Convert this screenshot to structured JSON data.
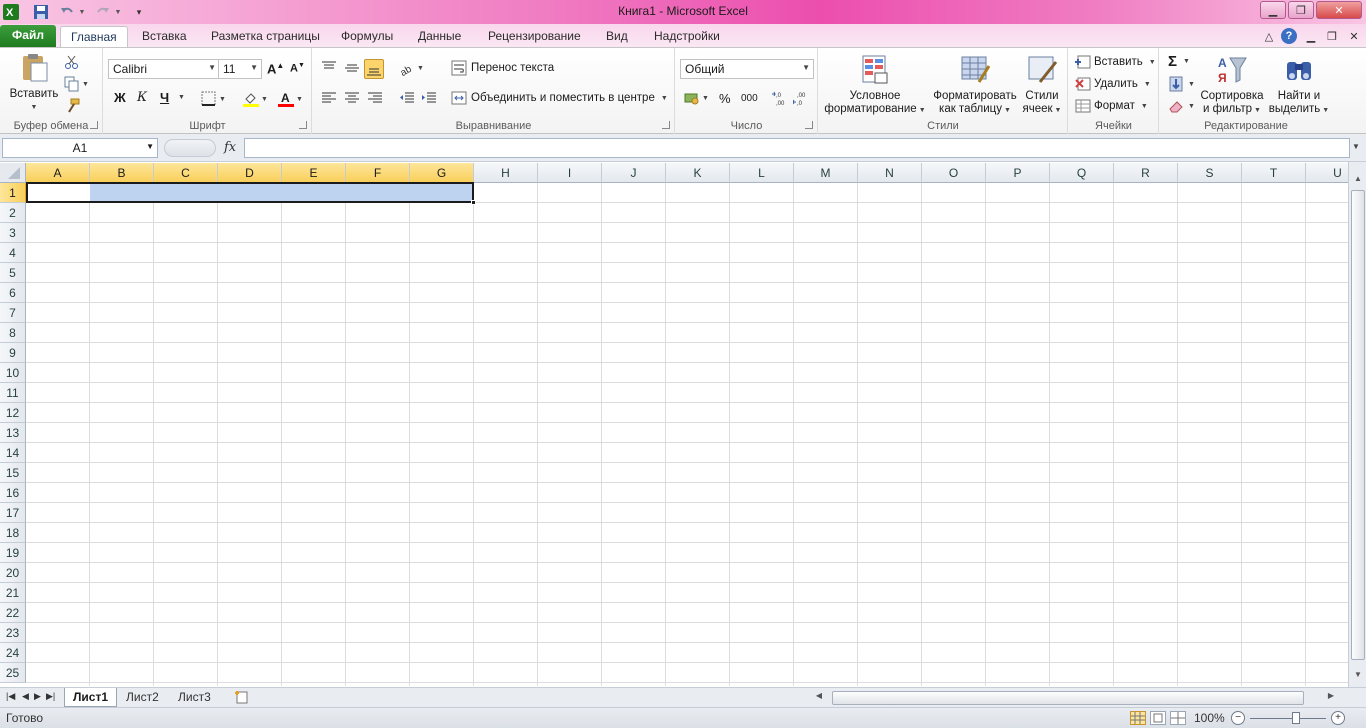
{
  "window": {
    "title": "Книга1  -  Microsoft Excel"
  },
  "tabs": {
    "file": "Файл",
    "items": [
      "Главная",
      "Вставка",
      "Разметка страницы",
      "Формулы",
      "Данные",
      "Рецензирование",
      "Вид",
      "Надстройки"
    ],
    "active": "Главная"
  },
  "ribbon": {
    "clipboard": {
      "paste": "Вставить",
      "label": "Буфер обмена"
    },
    "font": {
      "name": "Calibri",
      "size": "11",
      "bold": "Ж",
      "italic": "К",
      "underline": "Ч",
      "label": "Шрифт"
    },
    "alignment": {
      "wrap": "Перенос текста",
      "merge": "Объединить и поместить в центре",
      "label": "Выравнивание"
    },
    "number": {
      "format": "Общий",
      "percent": "%",
      "thousands": "000",
      "label": "Число"
    },
    "styles": {
      "conditional_l1": "Условное",
      "conditional_l2": "форматирование",
      "format_table_l1": "Форматировать",
      "format_table_l2": "как таблицу",
      "cell_styles_l1": "Стили",
      "cell_styles_l2": "ячеек",
      "label": "Стили"
    },
    "cells": {
      "insert": "Вставить",
      "delete": "Удалить",
      "format": "Формат",
      "label": "Ячейки"
    },
    "editing": {
      "sum": "Σ",
      "sort_l1": "Сортировка",
      "sort_l2": "и фильтр",
      "find_l1": "Найти и",
      "find_l2": "выделить",
      "label": "Редактирование"
    }
  },
  "formula_bar": {
    "name_box": "A1",
    "fx": "fx",
    "value": ""
  },
  "grid": {
    "columns": [
      "A",
      "B",
      "C",
      "D",
      "E",
      "F",
      "G",
      "H",
      "I",
      "J",
      "K",
      "L",
      "M",
      "N",
      "O",
      "P",
      "Q",
      "R",
      "S",
      "T",
      "U"
    ],
    "rows": [
      "1",
      "2",
      "3",
      "4",
      "5",
      "6",
      "7",
      "8",
      "9",
      "10",
      "11",
      "12",
      "13",
      "14",
      "15",
      "16",
      "17",
      "18",
      "19",
      "20",
      "21",
      "22",
      "23",
      "24",
      "25"
    ],
    "selected_columns": [
      "A",
      "B",
      "C",
      "D",
      "E",
      "F",
      "G"
    ],
    "selected_row": "1"
  },
  "sheets": {
    "items": [
      "Лист1",
      "Лист2",
      "Лист3"
    ],
    "active": "Лист1"
  },
  "status": {
    "text": "Готово",
    "zoom": "100%"
  },
  "colors": {
    "file_tab": "#2a8a2a",
    "title_gradient": "#ec4eae",
    "selection": "#bdd3ef",
    "header_selected": "#f9cf5a"
  }
}
